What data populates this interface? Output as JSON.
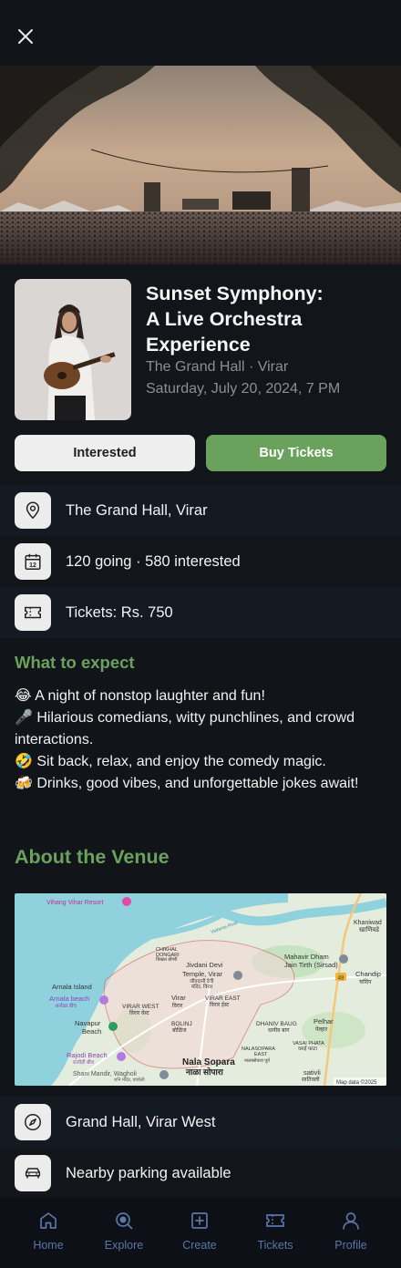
{
  "event": {
    "title_line1": "Sunset Symphony:",
    "title_line2": "A Live Orchestra",
    "title_line3": "Experience",
    "venue_line": "The Grand Hall · Virar",
    "date_line": "Saturday, July 20, 2024, 7 PM"
  },
  "actions": {
    "interested_label": "Interested",
    "buy_label": "Buy Tickets"
  },
  "info": {
    "location": "The Grand Hall, Virar",
    "attendance": "120 going · 580 interested",
    "tickets": "Tickets: Rs. 750",
    "calendar_day": "12"
  },
  "expect": {
    "heading": "What to expect",
    "lines": [
      "😂 A night of nonstop laughter and fun!",
      "🎤 Hilarious comedians, witty punchlines, and crowd interactions.",
      "🤣 Sit back, relax, and enjoy the comedy magic.",
      "🍻 Drinks, good vibes, and unforgettable jokes await!"
    ]
  },
  "venue": {
    "heading": "About the Venue",
    "map": {
      "labels": {
        "vihang": "Vihang Vihar Resort",
        "khaniwade": "Khaniwad",
        "khaniwade_mr": "खाणिवडे",
        "chikhal": "CHIKHAL",
        "dongari": "DONGARI",
        "chikhal_mr": "चिखल डोंगरी",
        "jivdani1": "Jivdani Devi",
        "jivdani2": "Temple, Virar",
        "jivdani_mr1": "जीवदानी देवी",
        "jivdani_mr2": "मंदिर, विरार",
        "mahavir1": "Mahavir Dham",
        "mahavir2": "Jain Tirth (Sirsad)",
        "chandip": "Chandip",
        "chandip_mr": "चांदिप",
        "highway": "48",
        "arnala_island": "Arnala Island",
        "arnala_beach": "Arnala beach",
        "arnala_beach_mr": "अर्नाळा बीच",
        "virar": "Virar",
        "virar_mr": "विरार",
        "virar_west": "VIRAR WEST",
        "virar_west_mr": "विरार वेस्ट",
        "virar_east": "VIRAR EAST",
        "virar_east_mr": "विरार ईस्ट",
        "navapur1": "Navapur",
        "navapur2": "Beach",
        "bolinj": "BOLINJ",
        "bolinj_mr": "बोळिंज",
        "dhaniv": "DHANIV BAUG",
        "dhaniv_mr": "धानीव बाग",
        "pelhar": "Pelhar",
        "pelhar_mr": "पेल्हार",
        "vasai_phata": "VASAI PHATA",
        "vasai_phata_mr": "वसई फाटा",
        "rajodi": "Rajodi Beach",
        "rajodi_mr": "राजोडी बीच",
        "nalasopara_e1": "NALASOPARA",
        "nalasopara_e2": "EAST",
        "nalasopara_e_mr": "नालासोपारा पूर्व",
        "nala_sopara": "Nala Sopara",
        "nala_sopara_mr": "नाळा सोपारा",
        "shani": "Shani Mandir, Wagholi",
        "shani_mr": "शनि मंदिर, वाघोली",
        "sativli": "sativli",
        "sativli_mr": "सातिवली",
        "attribution": "Map data ©2025",
        "vaitarna": "Vaitarna River"
      }
    },
    "address": "Grand Hall, Virar West",
    "parking": "Nearby parking available"
  },
  "nav": {
    "items": [
      {
        "label": "Home",
        "icon": "home-icon"
      },
      {
        "label": "Explore",
        "icon": "explore-icon"
      },
      {
        "label": "Create",
        "icon": "create-icon"
      },
      {
        "label": "Tickets",
        "icon": "tickets-icon"
      },
      {
        "label": "Profile",
        "icon": "profile-icon"
      }
    ]
  },
  "colors": {
    "accent": "#6aa25d",
    "background": "#111419",
    "nav_text": "#5b76a8"
  }
}
